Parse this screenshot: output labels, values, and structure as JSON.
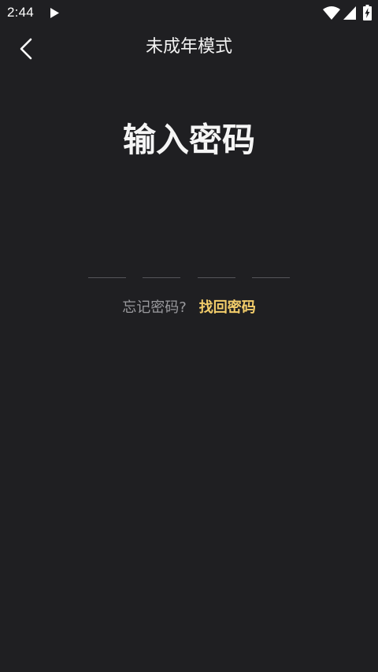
{
  "status_bar": {
    "time": "2:44",
    "icons": [
      "play-icon",
      "wifi-icon",
      "signal-icon",
      "battery-charging-icon"
    ]
  },
  "nav": {
    "back_icon": "chevron-left-icon",
    "title": "未成年模式"
  },
  "main": {
    "title": "输入密码",
    "pin_length": 4,
    "forgot_prompt": "忘记密码?",
    "recover_link": "找回密码"
  },
  "colors": {
    "background": "#1f1f22",
    "text_primary": "#ffffff",
    "text_secondary": "#9a9a9e",
    "accent": "#f3cd6a",
    "pin_underline": "#55555a"
  }
}
